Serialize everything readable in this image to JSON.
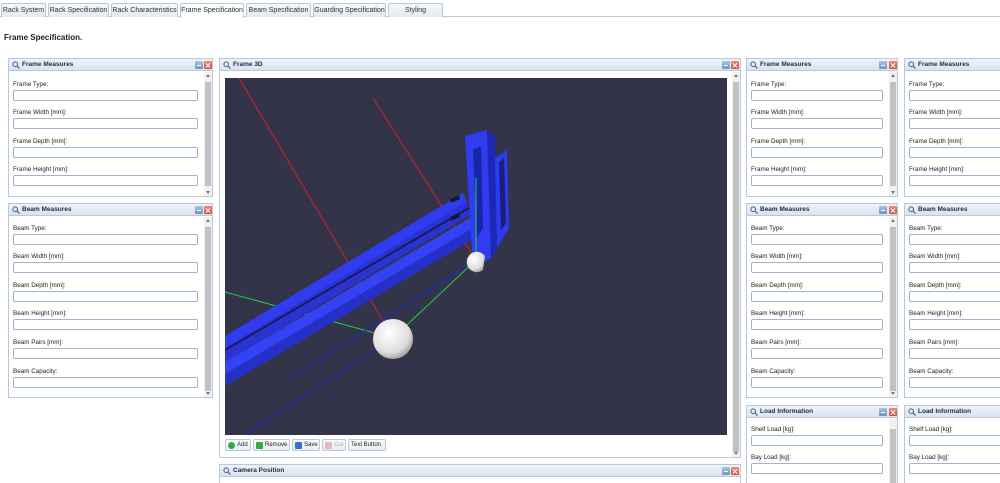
{
  "tabs": [
    {
      "label": "Rack System",
      "active": false
    },
    {
      "label": "Rack Specification",
      "active": false
    },
    {
      "label": "Rack Characteristics",
      "active": false
    },
    {
      "label": "Frame Specification",
      "active": true
    },
    {
      "label": "Beam Specification",
      "active": false
    },
    {
      "label": "Guarding Specification",
      "active": false
    },
    {
      "label": "Styling",
      "active": false
    }
  ],
  "page_title": "Frame Specification.",
  "frame_measures": {
    "title": "Frame Measures",
    "fields": [
      "Frame Type:",
      "Frame Width [mm]:",
      "Frame Depth [mm]:",
      "Frame Height [mm]:"
    ]
  },
  "beam_measures": {
    "title": "Beam Measures",
    "fields": [
      "Beam Type:",
      "Beam Width [mm]:",
      "Beam Depth [mm]:",
      "Beam Height [mm]:",
      "Beam Pairs [mm]:",
      "Beam Capacity:"
    ]
  },
  "load_information": {
    "title": "Load Information",
    "fields": [
      "Shelf Load [kg]:",
      "Bay Load [kg]:"
    ]
  },
  "frame3d": {
    "title": "Frame 3D",
    "toolbar": {
      "add": "Add",
      "remove": "Remove",
      "save": "Save",
      "cut": "Cut",
      "text_button": "Text Button"
    }
  },
  "camera_position": {
    "title": "Camera Position"
  },
  "colors": {
    "accent": "#1c2b3c",
    "border": "#b8c9de",
    "viewport_bg": "#33334a",
    "beam_blue": "#2f3cf0",
    "axis_red": "#d0202a",
    "axis_green": "#20d040",
    "axis_blue": "#1e28d8"
  }
}
